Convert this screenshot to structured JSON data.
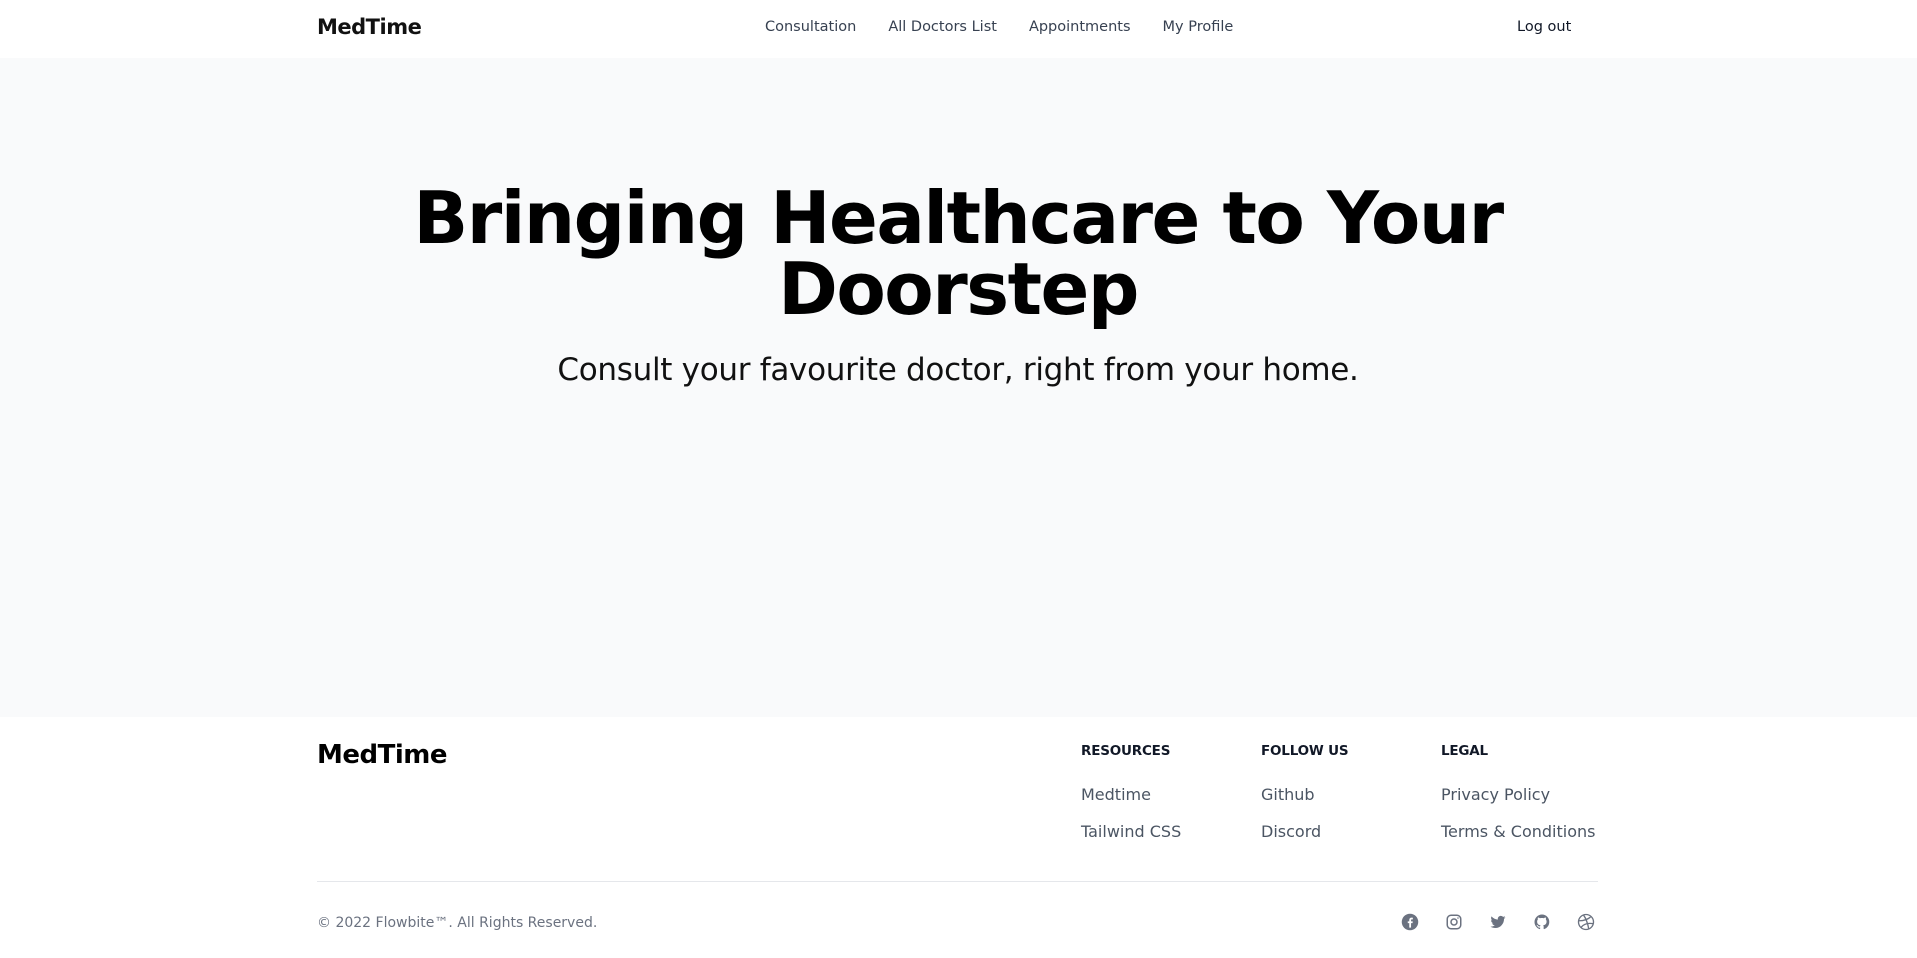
{
  "navbar": {
    "brand": "MedTime",
    "links": [
      "Consultation",
      "All Doctors List",
      "Appointments",
      "My Profile"
    ],
    "logout_label": "Log out"
  },
  "hero": {
    "title": "Bringing Healthcare to Your Doorstep",
    "subtitle": "Consult your favourite doctor, right from your home."
  },
  "footer": {
    "brand": "MedTime",
    "columns": [
      {
        "heading": "RESOURCES",
        "links": [
          "Medtime",
          "Tailwind CSS"
        ]
      },
      {
        "heading": "FOLLOW US",
        "links": [
          "Github",
          "Discord"
        ]
      },
      {
        "heading": "LEGAL",
        "links": [
          "Privacy Policy",
          "Terms & Conditions"
        ]
      }
    ],
    "copyright": "© 2022 Flowbite™. All Rights Reserved.",
    "social_icons": [
      "facebook-icon",
      "instagram-icon",
      "twitter-icon",
      "github-icon",
      "dribbble-icon"
    ]
  }
}
